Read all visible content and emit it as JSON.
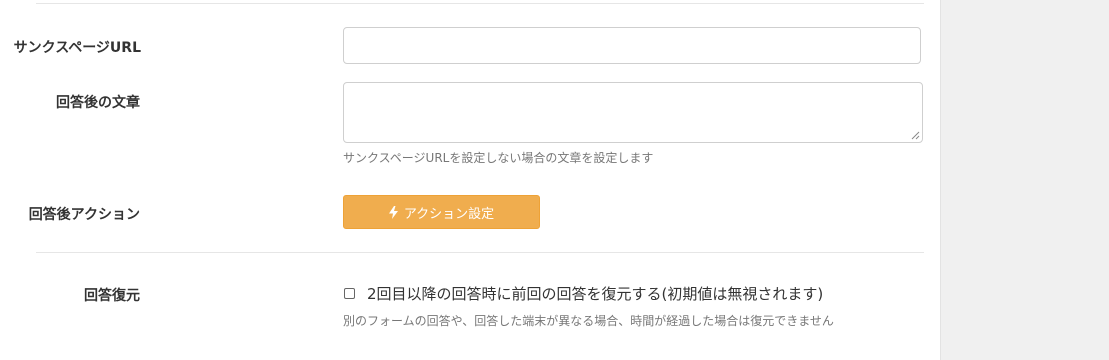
{
  "form": {
    "thanks_url": {
      "label": "サンクスページURL",
      "value": "",
      "placeholder": ""
    },
    "after_text": {
      "label": "回答後の文章",
      "value": "",
      "help": "サンクスページURLを設定しない場合の文章を設定します"
    },
    "after_action": {
      "label": "回答後アクション",
      "button_label": "アクション設定",
      "button_icon": "bolt-icon",
      "button_color": "#f0ad4e"
    },
    "restore": {
      "label": "回答復元",
      "checkbox_label": "2回目以降の回答時に前回の回答を復元する(初期値は無視されます)",
      "checked": false,
      "help": "別のフォームの回答や、回答した端末が異なる場合、時間が経過した場合は復元できません"
    }
  }
}
